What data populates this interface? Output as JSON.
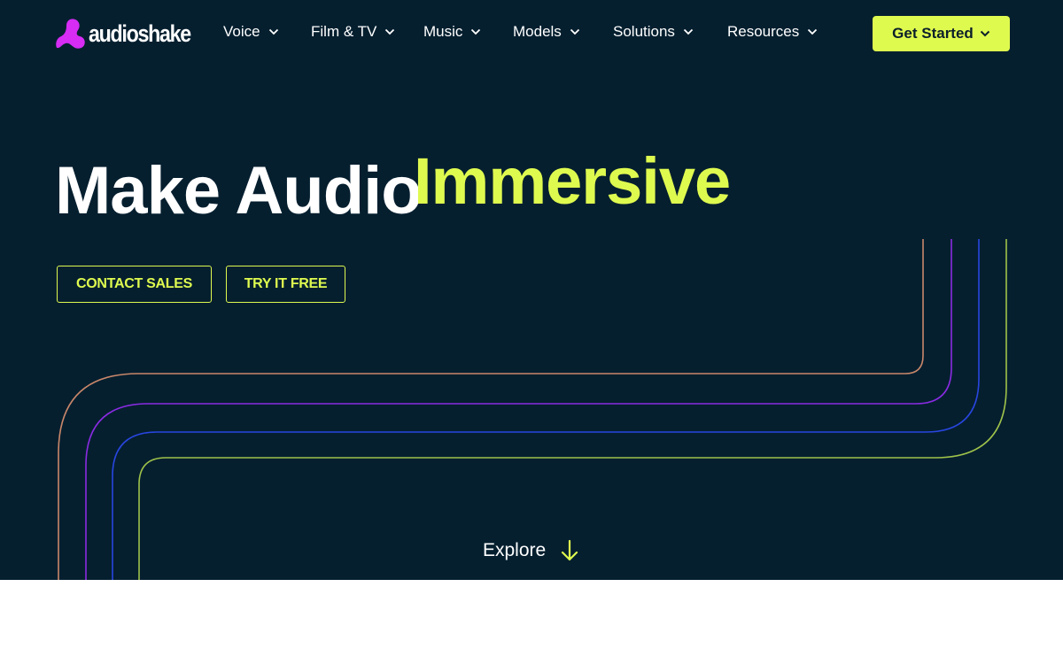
{
  "header": {
    "logo_text": "audioshake",
    "nav": [
      {
        "label": "Voice"
      },
      {
        "label": "Film & TV"
      },
      {
        "label": "Music"
      },
      {
        "label": "Models"
      },
      {
        "label": "Solutions"
      },
      {
        "label": "Resources"
      }
    ],
    "cta_label": "Get Started"
  },
  "hero": {
    "headline_main": "Make Audio",
    "headline_accent": "Immersive",
    "contact_sales": "CONTACT SALES",
    "try_free": "TRY IT FREE",
    "explore": "Explore"
  },
  "colors": {
    "background": "#051f2f",
    "accent": "#dffa4f",
    "brand_magenta": "#d62cf4",
    "line_1": "#c9876a",
    "line_2": "#8a2be2",
    "line_3": "#2846e0",
    "line_4": "#9fc24a"
  },
  "icons": {
    "logo": "audioshake-logo-icon",
    "nav_chevron": "chevron-down-icon",
    "explore_arrow": "arrow-down-icon"
  }
}
